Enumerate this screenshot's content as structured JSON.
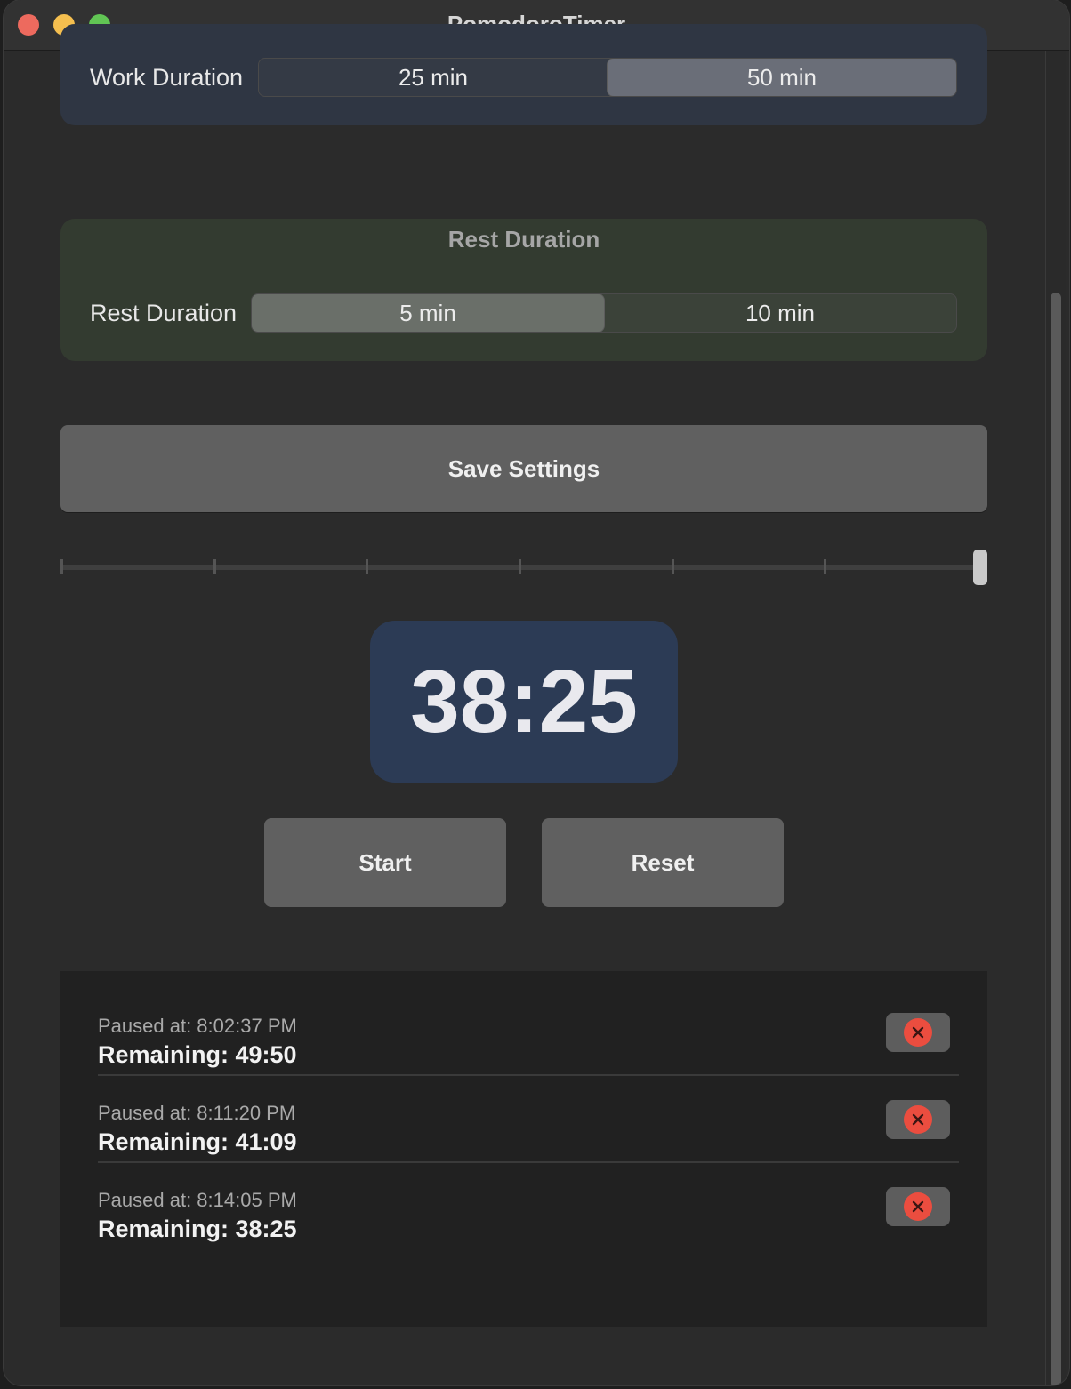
{
  "window": {
    "title": "PomodoroTimer"
  },
  "work": {
    "label": "Work Duration",
    "options": [
      "25 min",
      "50 min"
    ],
    "selected": "50 min"
  },
  "rest": {
    "section_title": "Rest Duration",
    "label": "Rest Duration",
    "options": [
      "5 min",
      "10 min"
    ],
    "selected": "5 min"
  },
  "save_label": "Save Settings",
  "slider": {
    "ticks": 7,
    "value_fraction": 1.0
  },
  "timer": {
    "display": "38:25"
  },
  "controls": {
    "start_label": "Start",
    "reset_label": "Reset"
  },
  "log": [
    {
      "paused": "Paused at: 8:02:37 PM",
      "remaining": "Remaining: 49:50"
    },
    {
      "paused": "Paused at: 8:11:20 PM",
      "remaining": "Remaining: 41:09"
    },
    {
      "paused": "Paused at: 8:14:05 PM",
      "remaining": "Remaining: 38:25"
    }
  ],
  "colors": {
    "work_bg": "#2f3643",
    "rest_bg": "#333b30",
    "timer_bg": "#2c3b55",
    "delete_red": "#eb4d3f"
  }
}
